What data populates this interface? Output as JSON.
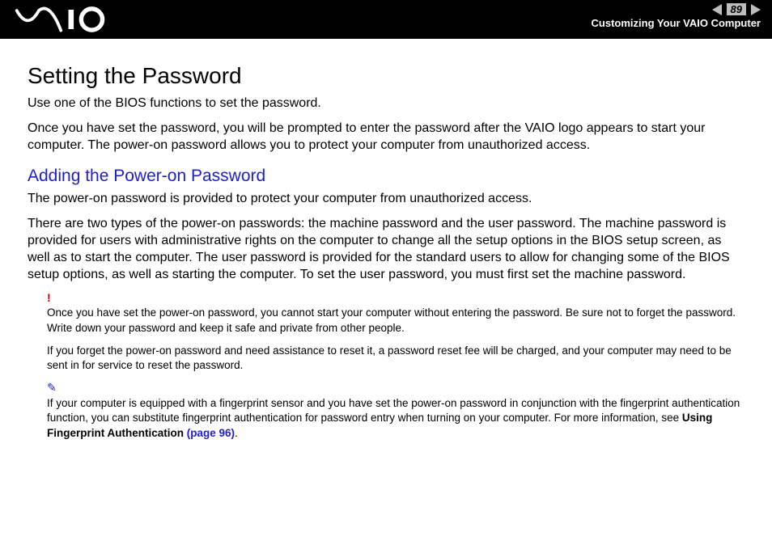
{
  "header": {
    "page_number": "89",
    "breadcrumb": "Customizing Your VAIO Computer"
  },
  "content": {
    "h1": "Setting the Password",
    "p1": "Use one of the BIOS functions to set the password.",
    "p2": "Once you have set the password, you will be prompted to enter the password after the VAIO logo appears to start your computer. The power-on password allows you to protect your computer from unauthorized access.",
    "h2": "Adding the Power-on Password",
    "p3": "The power-on password is provided to protect your computer from unauthorized access.",
    "p4": "There are two types of the power-on passwords: the machine password and the user password. The machine password is provided for users with administrative rights on the computer to change all the setup options in the BIOS setup screen, as well as to start the computer. The user password is provided for the standard users to allow for changing some of the BIOS setup options, as well as starting the computer. To set the user password, you must first set the machine password.",
    "warn_icon": "!",
    "warn1": "Once you have set the power-on password, you cannot start your computer without entering the password. Be sure not to forget the password. Write down your password and keep it safe and private from other people.",
    "warn2": "If you forget the power-on password and need assistance to reset it, a password reset fee will be charged, and your computer may need to be sent in for service to reset the password.",
    "tip_icon": "✎",
    "tip_prefix": "If your computer is equipped with a fingerprint sensor and you have set the power-on password in conjunction with the fingerprint authentication function, you can substitute fingerprint authentication for password entry when turning on your computer. For more information, see ",
    "tip_bold": "Using Fingerprint Authentication",
    "tip_link": " (page 96)",
    "tip_period": "."
  }
}
